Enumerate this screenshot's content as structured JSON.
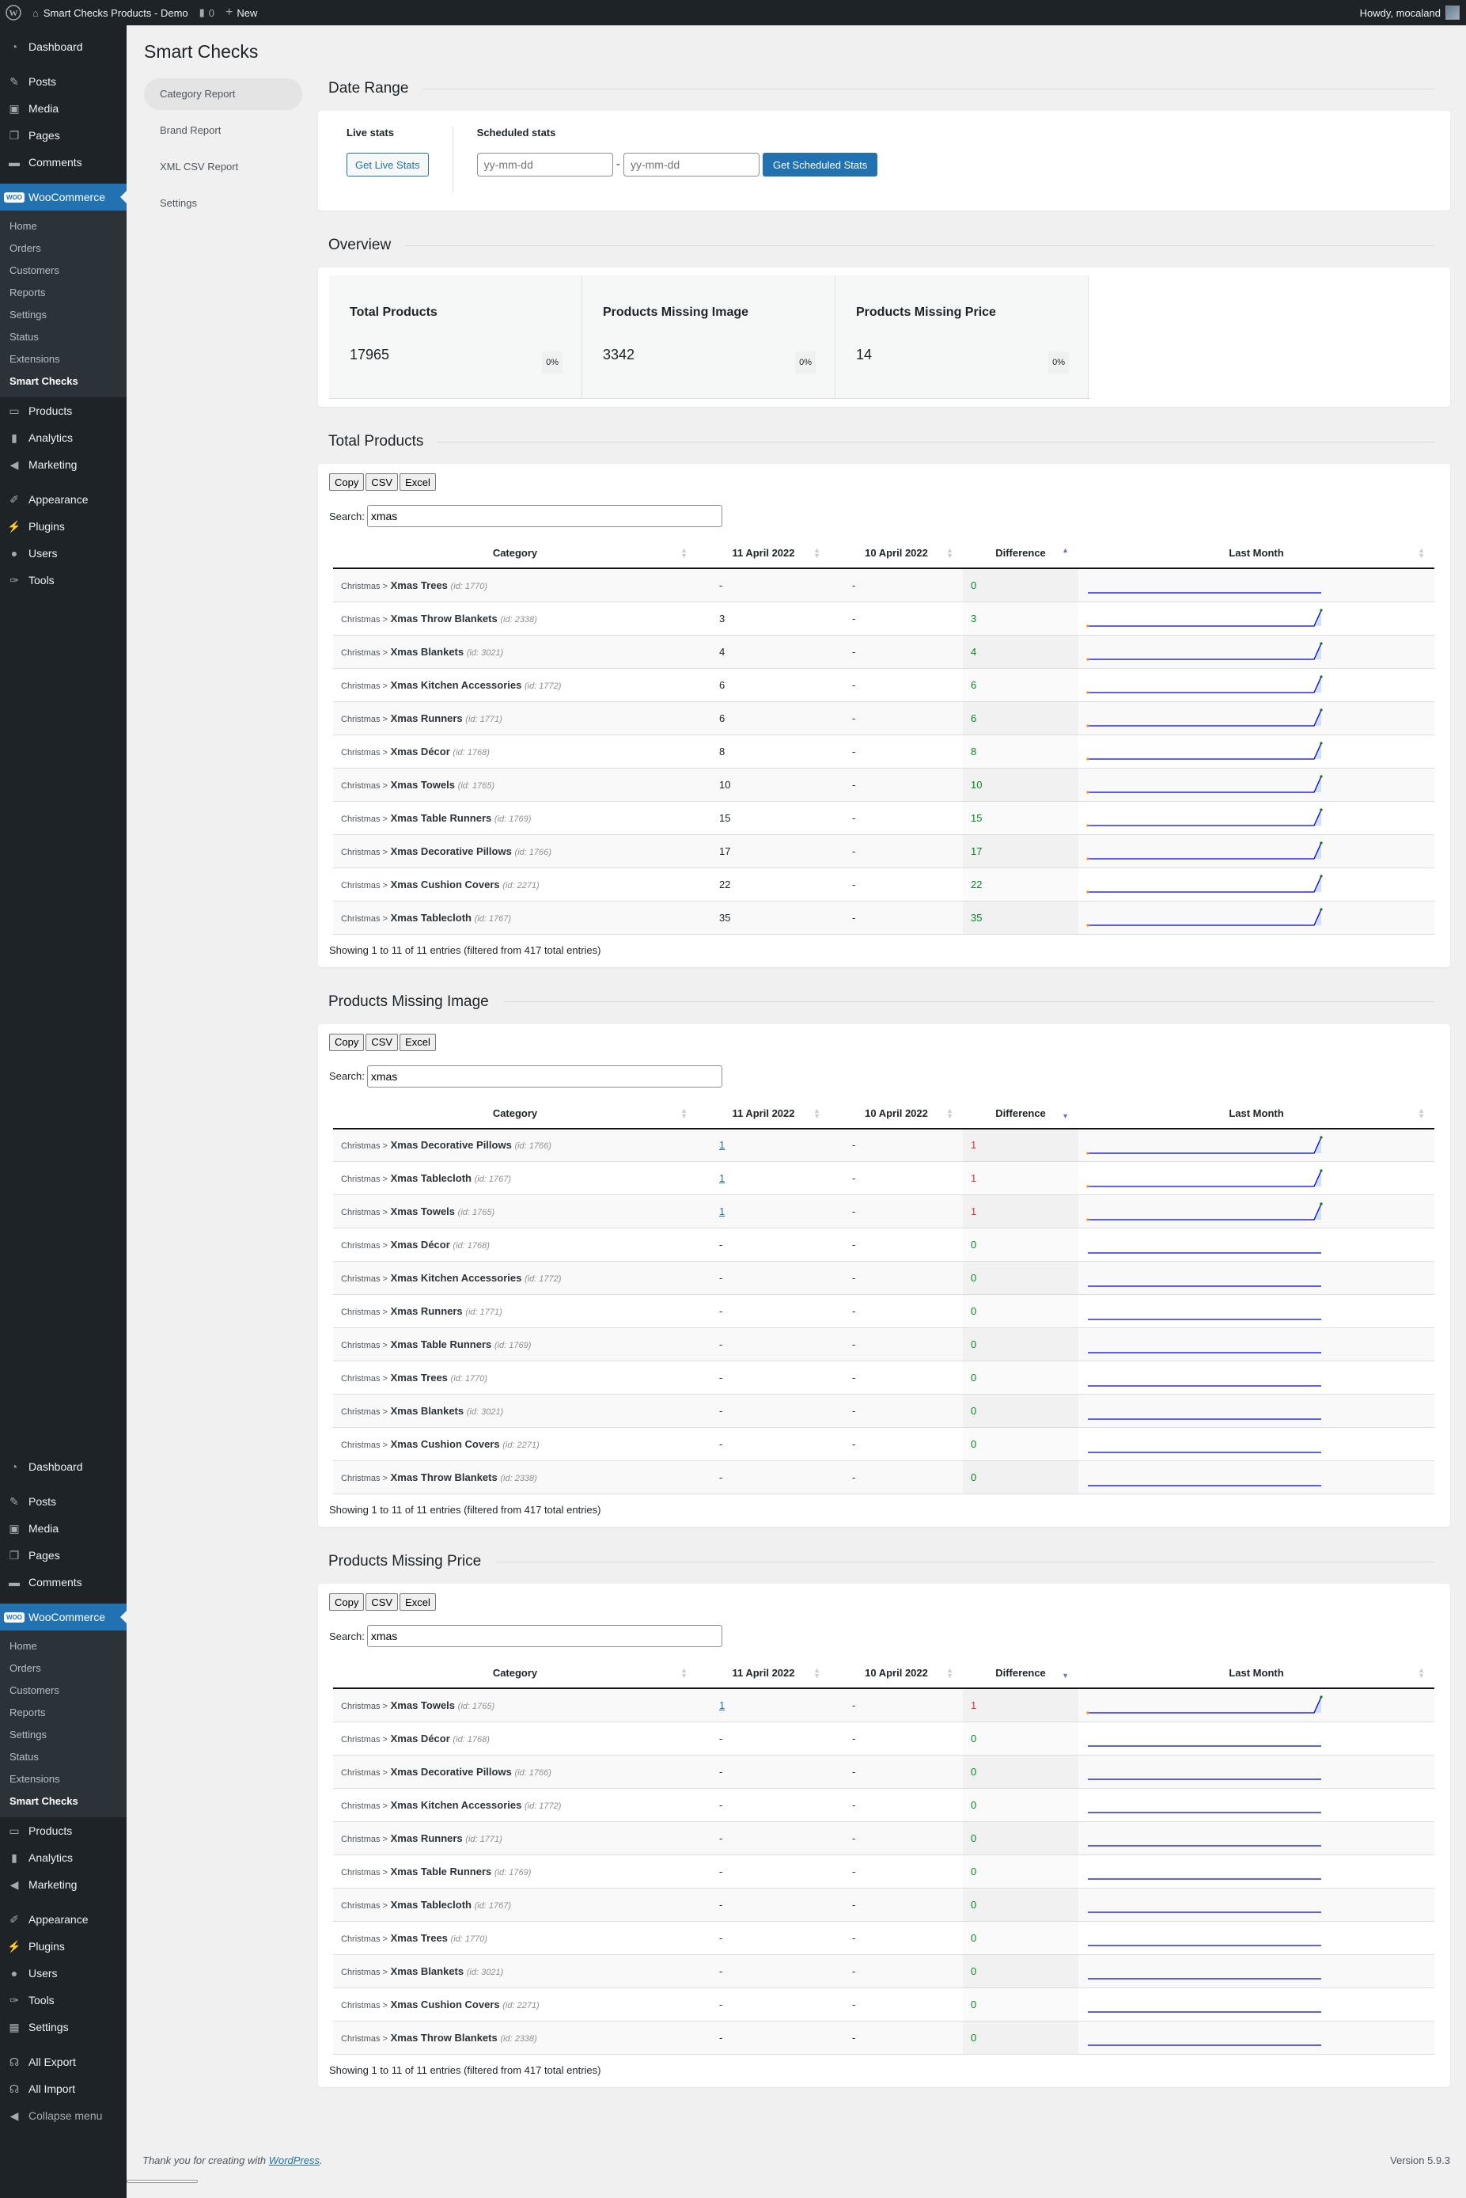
{
  "adminbar": {
    "site_name": "Smart Checks Products - Demo",
    "comments_count": "0",
    "new_label": "New",
    "howdy": "Howdy, mocaland"
  },
  "sidebar": {
    "top_items": [
      {
        "label": "Dashboard",
        "icon": "dashboard-icon"
      },
      {
        "label": "Posts",
        "icon": "pin-icon"
      },
      {
        "label": "Media",
        "icon": "media-icon"
      },
      {
        "label": "Pages",
        "icon": "pages-icon"
      },
      {
        "label": "Comments",
        "icon": "comment-icon"
      }
    ],
    "woocommerce": {
      "label": "WooCommerce",
      "submenu": [
        "Home",
        "Orders",
        "Customers",
        "Reports",
        "Settings",
        "Status",
        "Extensions",
        "Smart Checks"
      ],
      "active_sub": "Smart Checks"
    },
    "mid_items": [
      {
        "label": "Products",
        "icon": "archive-icon"
      },
      {
        "label": "Analytics",
        "icon": "bar-chart-icon"
      },
      {
        "label": "Marketing",
        "icon": "megaphone-icon"
      }
    ],
    "bottom_items": [
      {
        "label": "Appearance",
        "icon": "brush-icon"
      },
      {
        "label": "Plugins",
        "icon": "plugin-icon"
      },
      {
        "label": "Users",
        "icon": "user-icon"
      },
      {
        "label": "Tools",
        "icon": "wrench-icon"
      },
      {
        "label": "Settings",
        "icon": "sliders-icon"
      }
    ],
    "extra_items": [
      {
        "label": "All Export",
        "icon": "octopus-icon"
      },
      {
        "label": "All Import",
        "icon": "octopus-icon"
      }
    ],
    "collapse_label": "Collapse menu"
  },
  "page": {
    "title": "Smart Checks",
    "subnav": [
      "Category Report",
      "Brand Report",
      "XML CSV Report",
      "Settings"
    ],
    "subnav_active": "Category Report"
  },
  "date_range": {
    "title": "Date Range",
    "live_label": "Live stats",
    "live_button": "Get Live Stats",
    "scheduled_label": "Scheduled stats",
    "from_placeholder": "yy-mm-dd",
    "to_placeholder": "yy-mm-dd",
    "separator": "-",
    "scheduled_button": "Get Scheduled Stats"
  },
  "overview": {
    "title": "Overview",
    "cards": [
      {
        "title": "Total Products",
        "value": "17965",
        "change": "0%"
      },
      {
        "title": "Products Missing Image",
        "value": "3342",
        "change": "0%"
      },
      {
        "title": "Products Missing Price",
        "value": "14",
        "change": "0%"
      }
    ]
  },
  "table_common": {
    "tools": [
      "Copy",
      "CSV",
      "Excel"
    ],
    "search_label": "Search:",
    "columns": [
      "Category",
      "11 April 2022",
      "10 April 2022",
      "Difference",
      "Last Month"
    ]
  },
  "tables": [
    {
      "title": "Total Products",
      "search": "xmas",
      "sort": "asc",
      "info": "Showing 1 to 11 of 11 entries (filtered from 417 total entries)",
      "rows": [
        {
          "parent": "Christmas >",
          "name": "Xmas Trees",
          "id": "(id: 1770)",
          "d11": "-",
          "d10": "-",
          "diff": "0",
          "link": false,
          "trend": [
            0,
            0
          ]
        },
        {
          "parent": "Christmas >",
          "name": "Xmas Throw Blankets",
          "id": "(id: 2338)",
          "d11": "3",
          "d10": "-",
          "diff": "3",
          "link": false,
          "trend": [
            0,
            3
          ]
        },
        {
          "parent": "Christmas >",
          "name": "Xmas Blankets",
          "id": "(id: 3021)",
          "d11": "4",
          "d10": "-",
          "diff": "4",
          "link": false,
          "trend": [
            0,
            4
          ]
        },
        {
          "parent": "Christmas >",
          "name": "Xmas Kitchen Accessories",
          "id": "(id: 1772)",
          "d11": "6",
          "d10": "-",
          "diff": "6",
          "link": false,
          "trend": [
            0,
            6
          ]
        },
        {
          "parent": "Christmas >",
          "name": "Xmas Runners",
          "id": "(id: 1771)",
          "d11": "6",
          "d10": "-",
          "diff": "6",
          "link": false,
          "trend": [
            0,
            6
          ]
        },
        {
          "parent": "Christmas >",
          "name": "Xmas Décor",
          "id": "(id: 1768)",
          "d11": "8",
          "d10": "-",
          "diff": "8",
          "link": false,
          "trend": [
            0,
            8
          ]
        },
        {
          "parent": "Christmas >",
          "name": "Xmas Towels",
          "id": "(id: 1765)",
          "d11": "10",
          "d10": "-",
          "diff": "10",
          "link": false,
          "trend": [
            0,
            10
          ]
        },
        {
          "parent": "Christmas >",
          "name": "Xmas Table Runners",
          "id": "(id: 1769)",
          "d11": "15",
          "d10": "-",
          "diff": "15",
          "link": false,
          "trend": [
            0,
            15
          ]
        },
        {
          "parent": "Christmas >",
          "name": "Xmas Decorative Pillows",
          "id": "(id: 1766)",
          "d11": "17",
          "d10": "-",
          "diff": "17",
          "link": false,
          "trend": [
            0,
            17
          ]
        },
        {
          "parent": "Christmas >",
          "name": "Xmas Cushion Covers",
          "id": "(id: 2271)",
          "d11": "22",
          "d10": "-",
          "diff": "22",
          "link": false,
          "trend": [
            0,
            22
          ]
        },
        {
          "parent": "Christmas >",
          "name": "Xmas Tablecloth",
          "id": "(id: 1767)",
          "d11": "35",
          "d10": "-",
          "diff": "35",
          "link": false,
          "trend": [
            0,
            35
          ]
        }
      ]
    },
    {
      "title": "Products Missing Image",
      "search": "xmas",
      "sort": "desc",
      "info": "Showing 1 to 11 of 11 entries (filtered from 417 total entries)",
      "rows": [
        {
          "parent": "Christmas >",
          "name": "Xmas Decorative Pillows",
          "id": "(id: 1766)",
          "d11": "1",
          "d10": "-",
          "diff": "1",
          "link": true,
          "trend": [
            0,
            1
          ]
        },
        {
          "parent": "Christmas >",
          "name": "Xmas Tablecloth",
          "id": "(id: 1767)",
          "d11": "1",
          "d10": "-",
          "diff": "1",
          "link": true,
          "trend": [
            0,
            1
          ]
        },
        {
          "parent": "Christmas >",
          "name": "Xmas Towels",
          "id": "(id: 1765)",
          "d11": "1",
          "d10": "-",
          "diff": "1",
          "link": true,
          "trend": [
            0,
            1
          ]
        },
        {
          "parent": "Christmas >",
          "name": "Xmas Décor",
          "id": "(id: 1768)",
          "d11": "-",
          "d10": "-",
          "diff": "0",
          "link": false,
          "trend": [
            0,
            0
          ]
        },
        {
          "parent": "Christmas >",
          "name": "Xmas Kitchen Accessories",
          "id": "(id: 1772)",
          "d11": "-",
          "d10": "-",
          "diff": "0",
          "link": false,
          "trend": [
            0,
            0
          ]
        },
        {
          "parent": "Christmas >",
          "name": "Xmas Runners",
          "id": "(id: 1771)",
          "d11": "-",
          "d10": "-",
          "diff": "0",
          "link": false,
          "trend": [
            0,
            0
          ]
        },
        {
          "parent": "Christmas >",
          "name": "Xmas Table Runners",
          "id": "(id: 1769)",
          "d11": "-",
          "d10": "-",
          "diff": "0",
          "link": false,
          "trend": [
            0,
            0
          ]
        },
        {
          "parent": "Christmas >",
          "name": "Xmas Trees",
          "id": "(id: 1770)",
          "d11": "-",
          "d10": "-",
          "diff": "0",
          "link": false,
          "trend": [
            0,
            0
          ]
        },
        {
          "parent": "Christmas >",
          "name": "Xmas Blankets",
          "id": "(id: 3021)",
          "d11": "-",
          "d10": "-",
          "diff": "0",
          "link": false,
          "trend": [
            0,
            0
          ]
        },
        {
          "parent": "Christmas >",
          "name": "Xmas Cushion Covers",
          "id": "(id: 2271)",
          "d11": "-",
          "d10": "-",
          "diff": "0",
          "link": false,
          "trend": [
            0,
            0
          ]
        },
        {
          "parent": "Christmas >",
          "name": "Xmas Throw Blankets",
          "id": "(id: 2338)",
          "d11": "-",
          "d10": "-",
          "diff": "0",
          "link": false,
          "trend": [
            0,
            0
          ]
        }
      ]
    },
    {
      "title": "Products Missing Price",
      "search": "xmas",
      "sort": "desc",
      "info": "Showing 1 to 11 of 11 entries (filtered from 417 total entries)",
      "rows": [
        {
          "parent": "Christmas >",
          "name": "Xmas Towels",
          "id": "(id: 1765)",
          "d11": "1",
          "d10": "-",
          "diff": "1",
          "link": true,
          "trend": [
            0,
            1
          ]
        },
        {
          "parent": "Christmas >",
          "name": "Xmas Décor",
          "id": "(id: 1768)",
          "d11": "-",
          "d10": "-",
          "diff": "0",
          "link": false,
          "trend": [
            0,
            0
          ]
        },
        {
          "parent": "Christmas >",
          "name": "Xmas Decorative Pillows",
          "id": "(id: 1766)",
          "d11": "-",
          "d10": "-",
          "diff": "0",
          "link": false,
          "trend": [
            0,
            0
          ]
        },
        {
          "parent": "Christmas >",
          "name": "Xmas Kitchen Accessories",
          "id": "(id: 1772)",
          "d11": "-",
          "d10": "-",
          "diff": "0",
          "link": false,
          "trend": [
            0,
            0
          ]
        },
        {
          "parent": "Christmas >",
          "name": "Xmas Runners",
          "id": "(id: 1771)",
          "d11": "-",
          "d10": "-",
          "diff": "0",
          "link": false,
          "trend": [
            0,
            0
          ]
        },
        {
          "parent": "Christmas >",
          "name": "Xmas Table Runners",
          "id": "(id: 1769)",
          "d11": "-",
          "d10": "-",
          "diff": "0",
          "link": false,
          "trend": [
            0,
            0
          ]
        },
        {
          "parent": "Christmas >",
          "name": "Xmas Tablecloth",
          "id": "(id: 1767)",
          "d11": "-",
          "d10": "-",
          "diff": "0",
          "link": false,
          "trend": [
            0,
            0
          ]
        },
        {
          "parent": "Christmas >",
          "name": "Xmas Trees",
          "id": "(id: 1770)",
          "d11": "-",
          "d10": "-",
          "diff": "0",
          "link": false,
          "trend": [
            0,
            0
          ]
        },
        {
          "parent": "Christmas >",
          "name": "Xmas Blankets",
          "id": "(id: 3021)",
          "d11": "-",
          "d10": "-",
          "diff": "0",
          "link": false,
          "trend": [
            0,
            0
          ]
        },
        {
          "parent": "Christmas >",
          "name": "Xmas Cushion Covers",
          "id": "(id: 2271)",
          "d11": "-",
          "d10": "-",
          "diff": "0",
          "link": false,
          "trend": [
            0,
            0
          ]
        },
        {
          "parent": "Christmas >",
          "name": "Xmas Throw Blankets",
          "id": "(id: 2338)",
          "d11": "-",
          "d10": "-",
          "diff": "0",
          "link": false,
          "trend": [
            0,
            0
          ]
        }
      ]
    }
  ],
  "colors": {
    "accent": "#2271b1",
    "positive": "#008a20",
    "negative": "#d63638",
    "sparkline": "#0000dd",
    "spark_fill": "#cfe0fb",
    "spark_start": "#ff8c00",
    "spark_end": "#008000"
  },
  "footer": {
    "thanks_prefix": "Thank you for creating with ",
    "link_text": "WordPress",
    "thanks_suffix": ".",
    "version": "Version 5.9.3"
  }
}
